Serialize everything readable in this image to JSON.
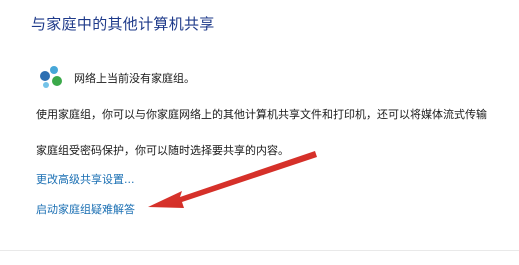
{
  "section": {
    "title": "与家庭中的其他计算机共享"
  },
  "status": {
    "text": "网络上当前没有家庭组。",
    "icon": "homegroup-icon"
  },
  "description": {
    "line1": "使用家庭组，你可以与你家庭网络上的其他计算机共享文件和打印机，还可以将媒体流式传输",
    "line2": "家庭组受密码保护，你可以随时选择要共享的内容。"
  },
  "links": {
    "advanced_sharing": "更改高级共享设置...",
    "troubleshoot": "启动家庭组疑难解答"
  },
  "annotation": {
    "arrow_color": "#e0312b"
  }
}
